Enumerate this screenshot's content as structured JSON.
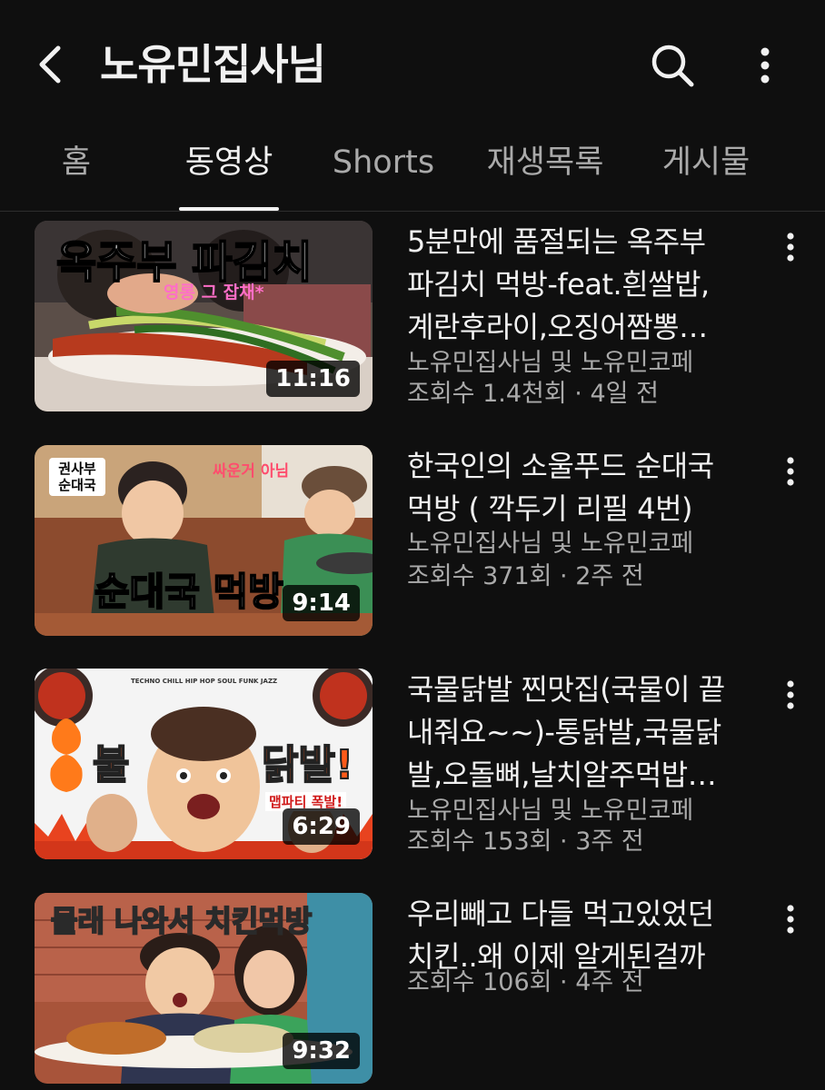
{
  "header": {
    "channel_name": "노유민집사님",
    "back_icon": "back-arrow-icon",
    "search_icon": "search-icon",
    "more_icon": "more-vert-icon"
  },
  "tabs": [
    {
      "label": "홈"
    },
    {
      "label": "동영상",
      "active": true
    },
    {
      "label": "Shorts"
    },
    {
      "label": "재생목록"
    },
    {
      "label": "게시물"
    }
  ],
  "videos": [
    {
      "title_lines": [
        "5분만에 품절되는 옥주부",
        "파김치 먹방-feat.흰쌀밥,",
        "계란후라이,오징어짬뽕…"
      ],
      "channel": "노유민집사님 및 노유민코페",
      "stats": "조회수 1.4천회 · 4일 전",
      "duration": "11:16",
      "thumb_text": {
        "main": "옥주부 파김치",
        "sub": "영롱 그 잡채*"
      }
    },
    {
      "title_lines": [
        "한국인의 소울푸드 순대국",
        "먹방 ( 깍두기 리필 4번)"
      ],
      "channel": "노유민집사님 및 노유민코페",
      "stats": "조회수 371회 · 2주 전",
      "duration": "9:14",
      "thumb_text": {
        "main": "순대국 먹방",
        "tag": "권사부 순대국",
        "sub": "싸운거 아님"
      }
    },
    {
      "title_lines": [
        "국물닭발 찐맛집(국물이 끝",
        "내줘요~~)-통닭발,국물닭",
        "발,오돌뼈,날치알주먹밥…"
      ],
      "channel": "노유민집사님 및 노유민코페",
      "stats": "조회수 153회 · 3주 전",
      "duration": "6:29",
      "thumb_text": {
        "left": "불",
        "right": "닭발!",
        "sub": "맵파티 폭발!",
        "genres": "TECHNO   CHILL   HIP HOP   SOUL   FUNK   JAZZ"
      }
    },
    {
      "title_lines": [
        "우리빼고 다들 먹고있었던",
        "치킨..왜 이제 알게된걸까"
      ],
      "channel": "",
      "stats": "조회수 106회 · 4주 전",
      "duration": "9:32",
      "thumb_text": {
        "main": "몰래 나와서 치킨먹방"
      }
    }
  ]
}
